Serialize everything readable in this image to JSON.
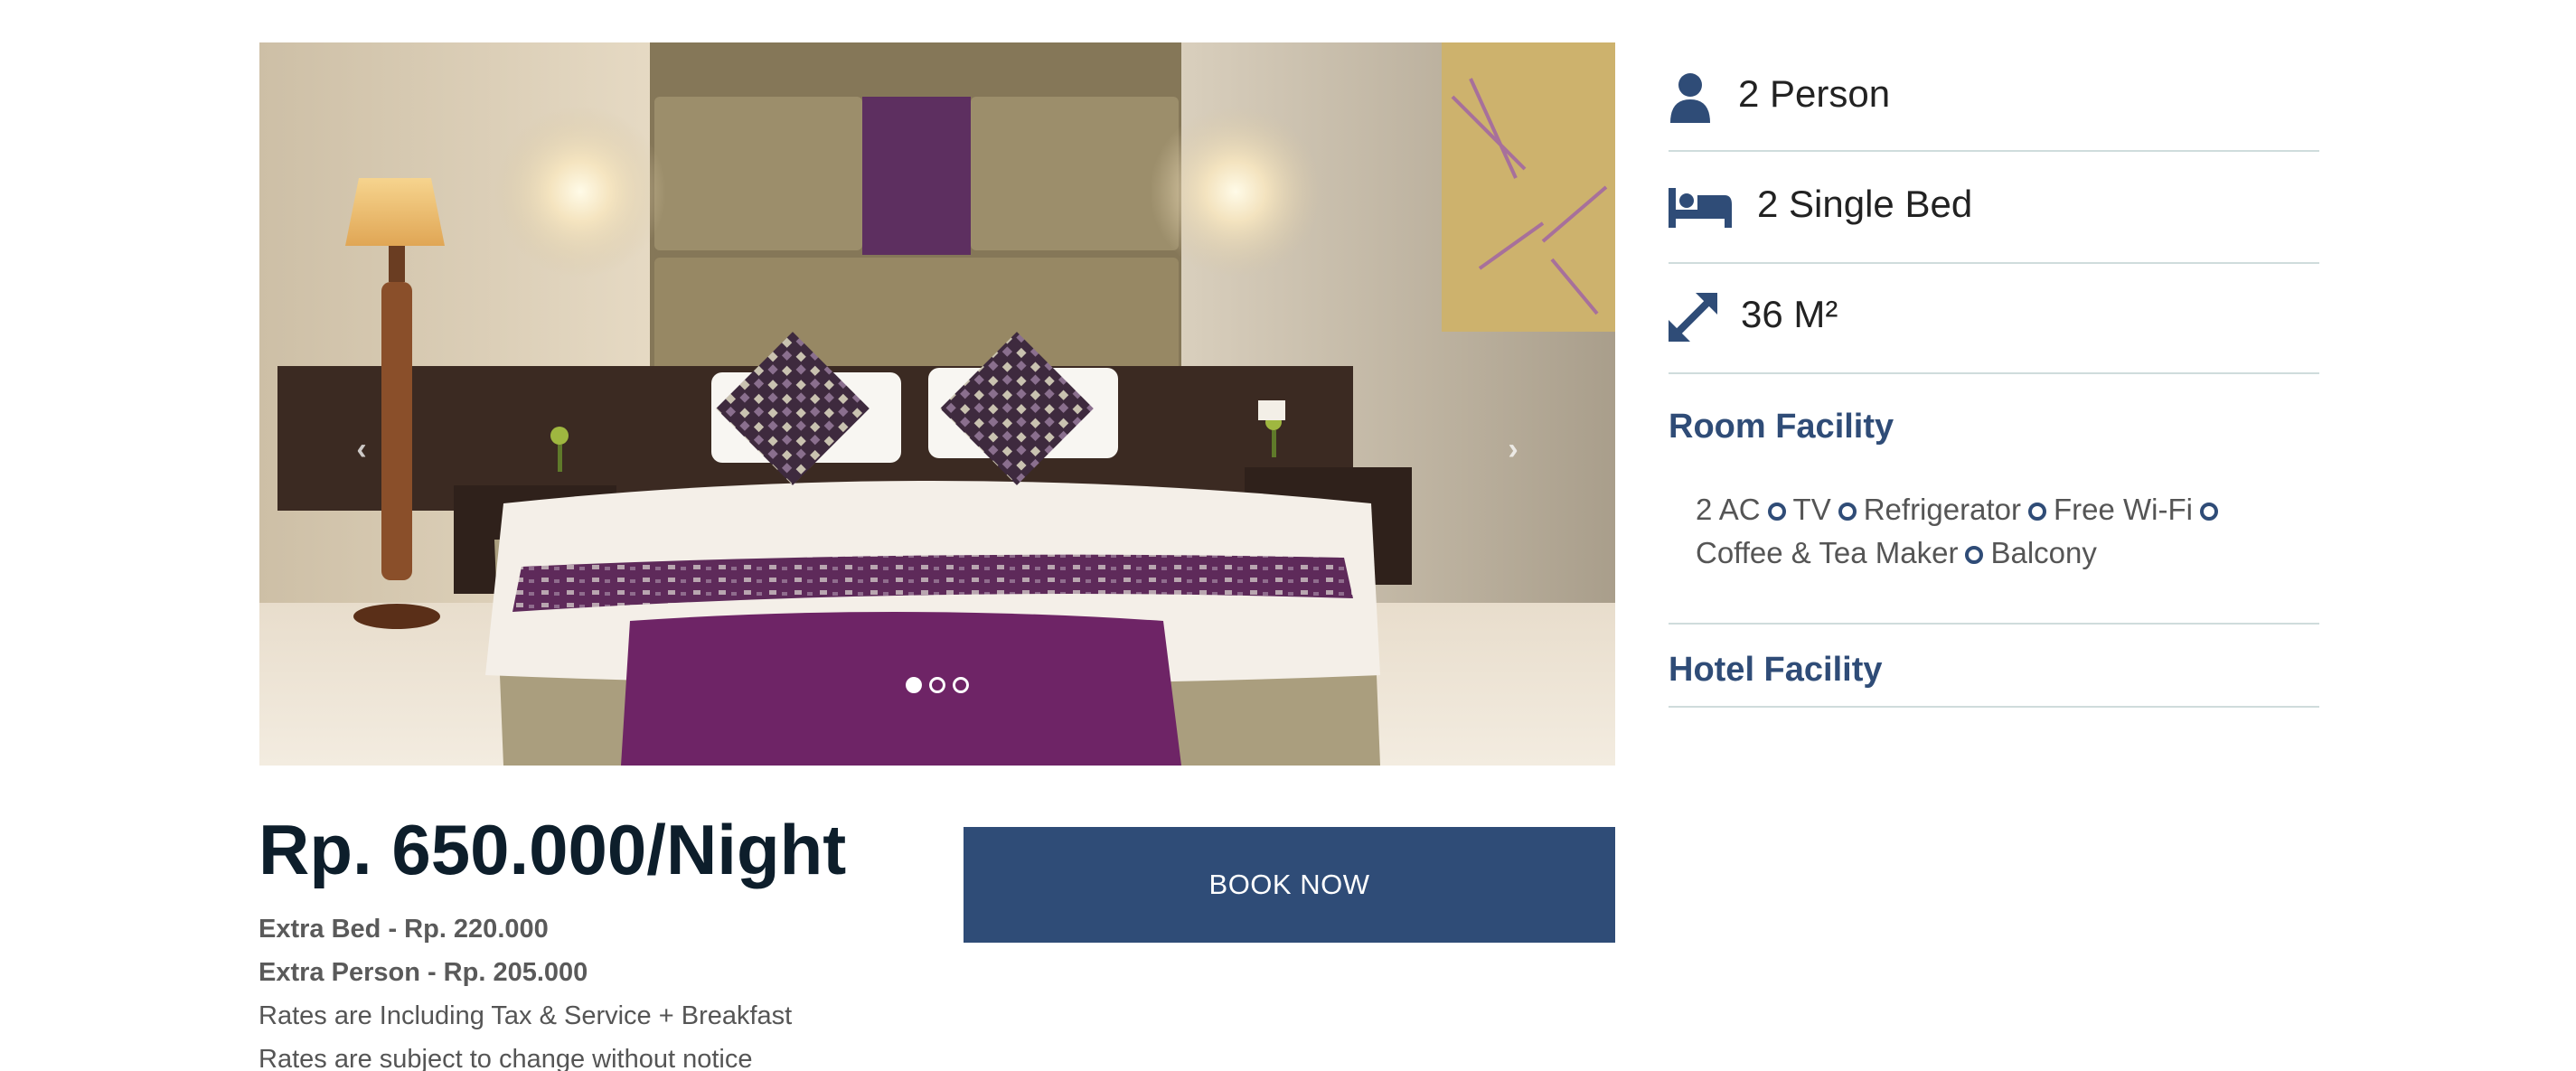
{
  "carousel": {
    "prev_icon": "chevron-left-icon",
    "next_icon": "chevron-right-icon",
    "prev_symbol": "‹",
    "next_symbol": "›",
    "slide_count": 3,
    "active_slide": 1
  },
  "pricing": {
    "price": "Rp. 650.000/Night",
    "extra_bed": "Extra Bed - Rp. 220.000",
    "extra_person": "Extra Person - Rp. 205.000",
    "note_tax": "Rates are Including Tax & Service + Breakfast",
    "note_change": "Rates are subject to change without notice"
  },
  "actions": {
    "book_label": "BOOK NOW"
  },
  "room_info": {
    "guests": "2 Person",
    "beds": "2 Single Bed",
    "size": "36 M²"
  },
  "room_facility": {
    "title": "Room Facility",
    "items": [
      "2 AC",
      "TV",
      "Refrigerator",
      "Free Wi-Fi",
      "Coffee & Tea Maker",
      "Balcony"
    ]
  },
  "hotel_facility": {
    "title": "Hotel Facility"
  },
  "colors": {
    "accent": "#2f4c77",
    "divider": "#cfdcdc",
    "price_text": "#0d1e2b"
  }
}
